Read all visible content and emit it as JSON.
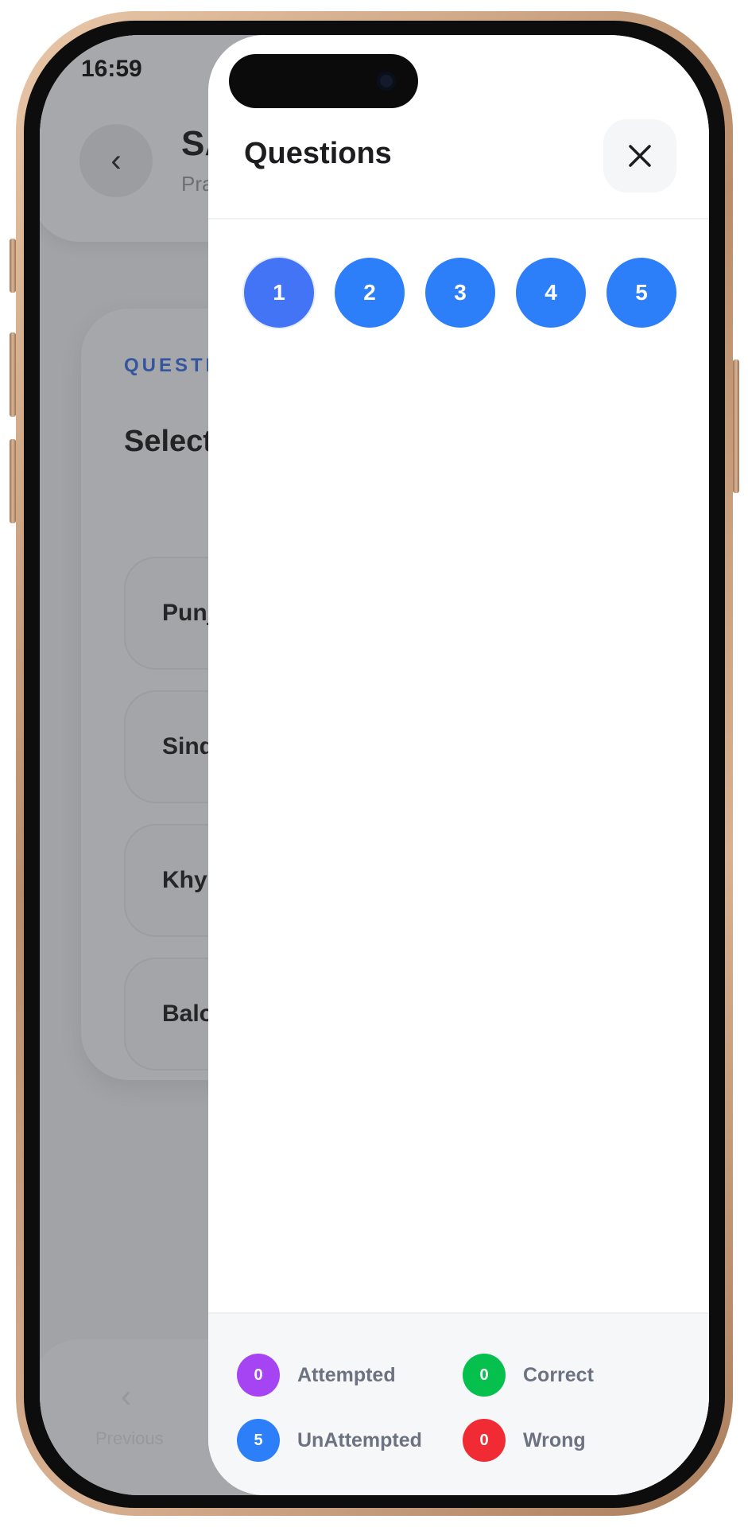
{
  "status_bar": {
    "time": "16:59"
  },
  "background_app": {
    "header": {
      "back_icon": "chevron-left-icon",
      "title": "SA",
      "subtitle": "Pra"
    },
    "question_label": "QUESTIC",
    "question_text": "Select",
    "options": [
      "Punj",
      "Sind",
      "Khyl",
      "Balo"
    ],
    "bottom_nav": {
      "previous_icon": "chevron-left-icon",
      "previous_label": "Previous"
    }
  },
  "drawer": {
    "title": "Questions",
    "close_icon": "close-icon",
    "questions": [
      "1",
      "2",
      "3",
      "4",
      "5"
    ],
    "current_question": "1",
    "legend": [
      {
        "key": "attempted",
        "count": "0",
        "label": "Attempted",
        "color": "#a644f4"
      },
      {
        "key": "correct",
        "count": "0",
        "label": "Correct",
        "color": "#06c04e"
      },
      {
        "key": "unattempted",
        "count": "5",
        "label": "UnAttempted",
        "color": "#2d7ff9"
      },
      {
        "key": "wrong",
        "count": "0",
        "label": "Wrong",
        "color": "#f02b34"
      }
    ]
  }
}
